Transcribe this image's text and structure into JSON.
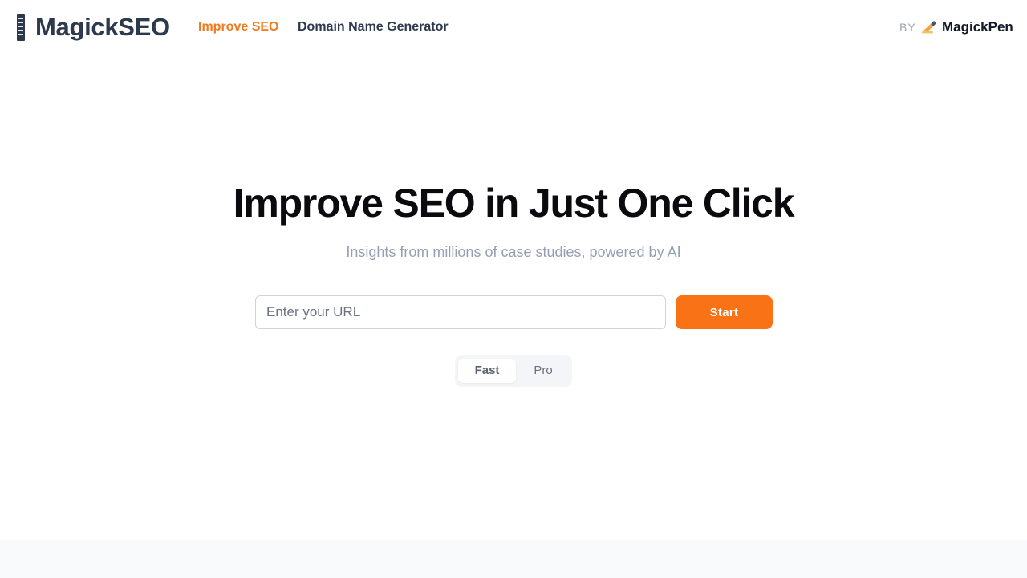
{
  "header": {
    "logo_text": "MagickSEO",
    "logo_icon": "book-spine-icon",
    "nav": [
      {
        "label": "Improve SEO",
        "active": true
      },
      {
        "label": "Domain Name Generator",
        "active": false
      }
    ],
    "by_label": "BY",
    "brand_icon": "writing-hand-icon",
    "brand_name": "MagickPen"
  },
  "hero": {
    "title": "Improve SEO in Just One Click",
    "subtitle": "Insights from millions of case studies, powered by AI"
  },
  "form": {
    "url_value": "",
    "url_placeholder": "Enter your URL",
    "start_label": "Start"
  },
  "mode_toggle": {
    "options": [
      "Fast",
      "Pro"
    ],
    "selected": "Fast"
  },
  "colors": {
    "accent": "#f97316",
    "nav_active": "#f07a1e",
    "text_dark": "#2d3a4e",
    "subtitle": "#94a0b2"
  }
}
